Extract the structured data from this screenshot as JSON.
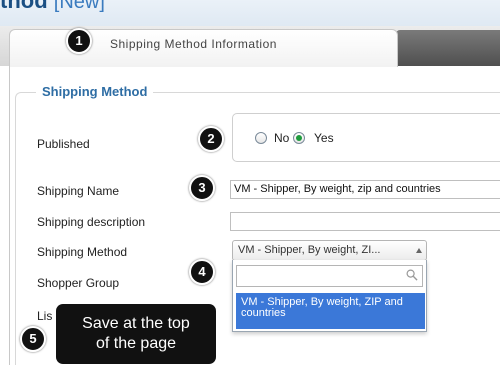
{
  "header": {
    "title": "thod",
    "title_suffix": "[New]"
  },
  "tabs": [
    {
      "label": "Shipping Method Information",
      "active": true
    }
  ],
  "form": {
    "section_title": "Shipping Method",
    "published": {
      "label": "Published",
      "options": [
        "No",
        "Yes"
      ],
      "selected": "Yes"
    },
    "shipping_name": {
      "label": "Shipping Name",
      "value": "VM - Shipper, By weight, zip and countries"
    },
    "shipping_description": {
      "label": "Shipping description",
      "value": ""
    },
    "shipping_method": {
      "label": "Shipping Method",
      "selected": "VM - Shipper, By weight, ZI...",
      "search_value": "",
      "options": [
        "VM - Shipper, By weight, ZIP and countries"
      ]
    },
    "shopper_group": {
      "label": "Shopper Group"
    },
    "list_order": {
      "label": "Lis"
    }
  },
  "callouts": [
    "1",
    "2",
    "3",
    "4",
    "5"
  ],
  "tooltip": {
    "text_line1": "Save at the top",
    "text_line2": "of the page"
  },
  "colors": {
    "title": "#1b4f83",
    "section_title": "#2e6da4",
    "highlight": "#3b78d8",
    "radio_checked": "#1e9b3c"
  }
}
